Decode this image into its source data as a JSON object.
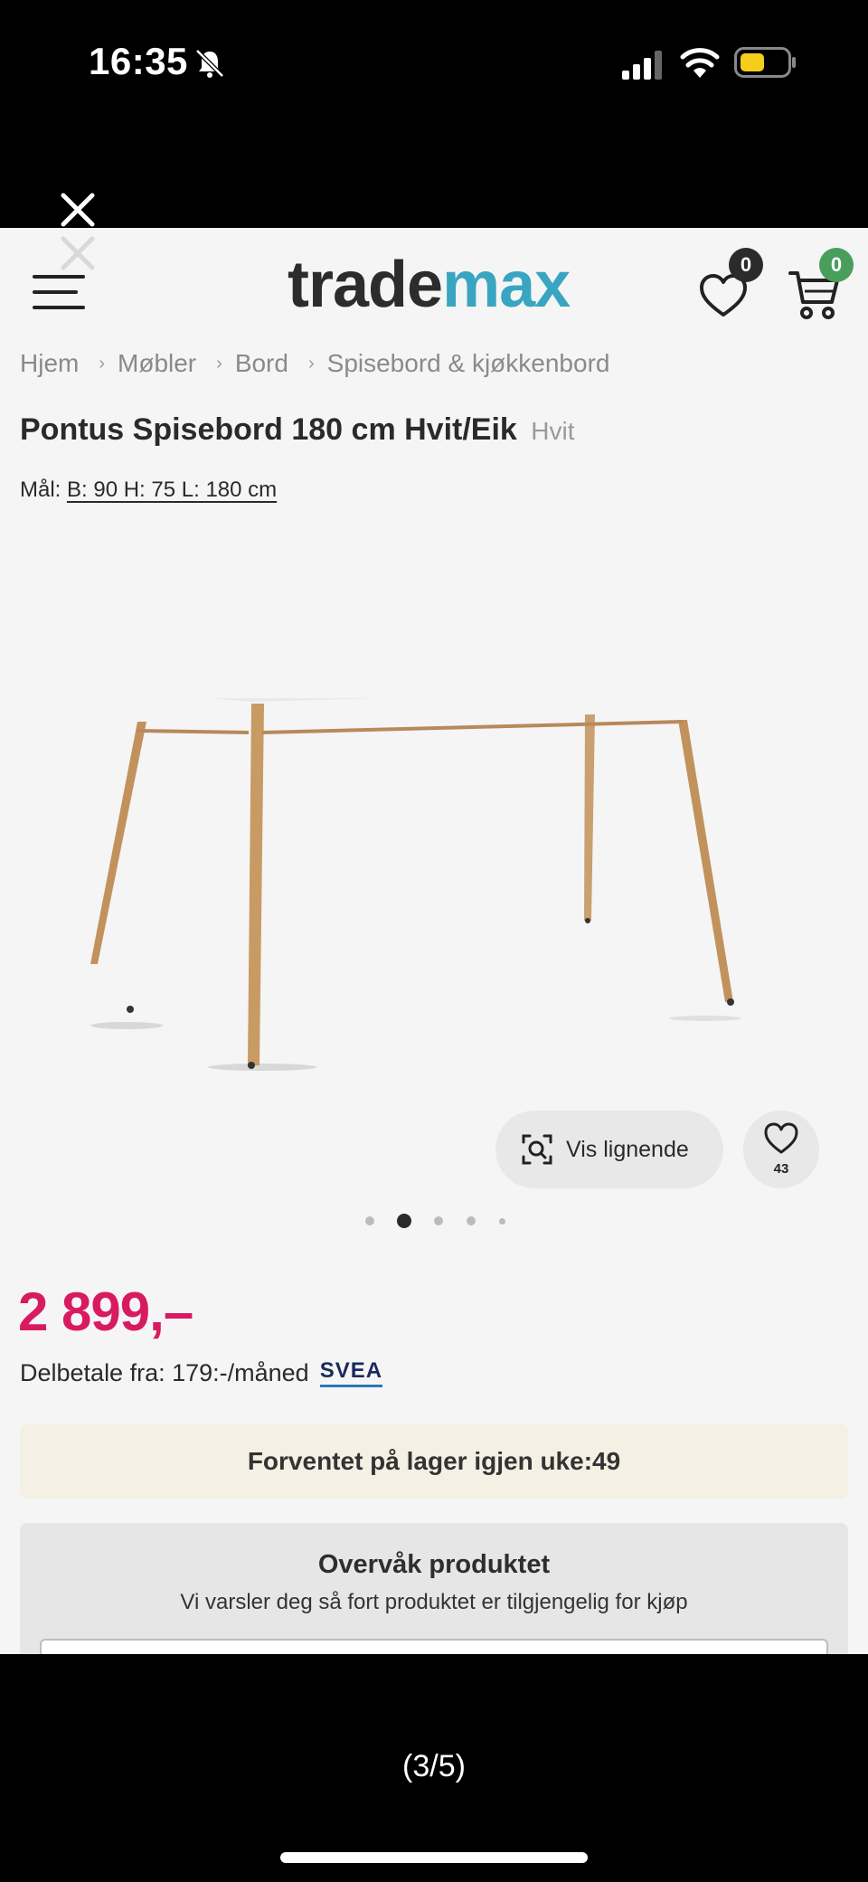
{
  "status_bar": {
    "time": "16:35"
  },
  "header": {
    "logo_part1": "trade",
    "logo_part2": "max",
    "wishlist_count": "0",
    "cart_count": "0"
  },
  "breadcrumb": [
    "Hjem",
    "Møbler",
    "Bord",
    "Spisebord & kjøkkenbord"
  ],
  "product": {
    "title": "Pontus Spisebord 180 cm Hvit/Eik",
    "variant": "Hvit",
    "dimensions_label": "Mål:",
    "dimensions_value": "B: 90 H: 75 L: 180 cm",
    "similar_label": "Vis lignende",
    "favorite_count": "43",
    "image_count": 5,
    "active_image": 2,
    "price": "2 899,–",
    "installment_text": "Delbetale fra: 179:-/måned",
    "installment_provider": "SVEA",
    "stock_notice": "Forventet på lager igjen uke:49",
    "watch_title": "Overvåk produktet",
    "watch_description": "Vi varsler deg så fort produktet er tilgjengelig for kjøp"
  },
  "viewer": {
    "pager": "(3/5)"
  },
  "colors": {
    "price": "#d81b60",
    "logo_accent": "#3aa5c1",
    "cart_badge": "#4a9e5c",
    "stock_banner": "#f4f1e4"
  }
}
